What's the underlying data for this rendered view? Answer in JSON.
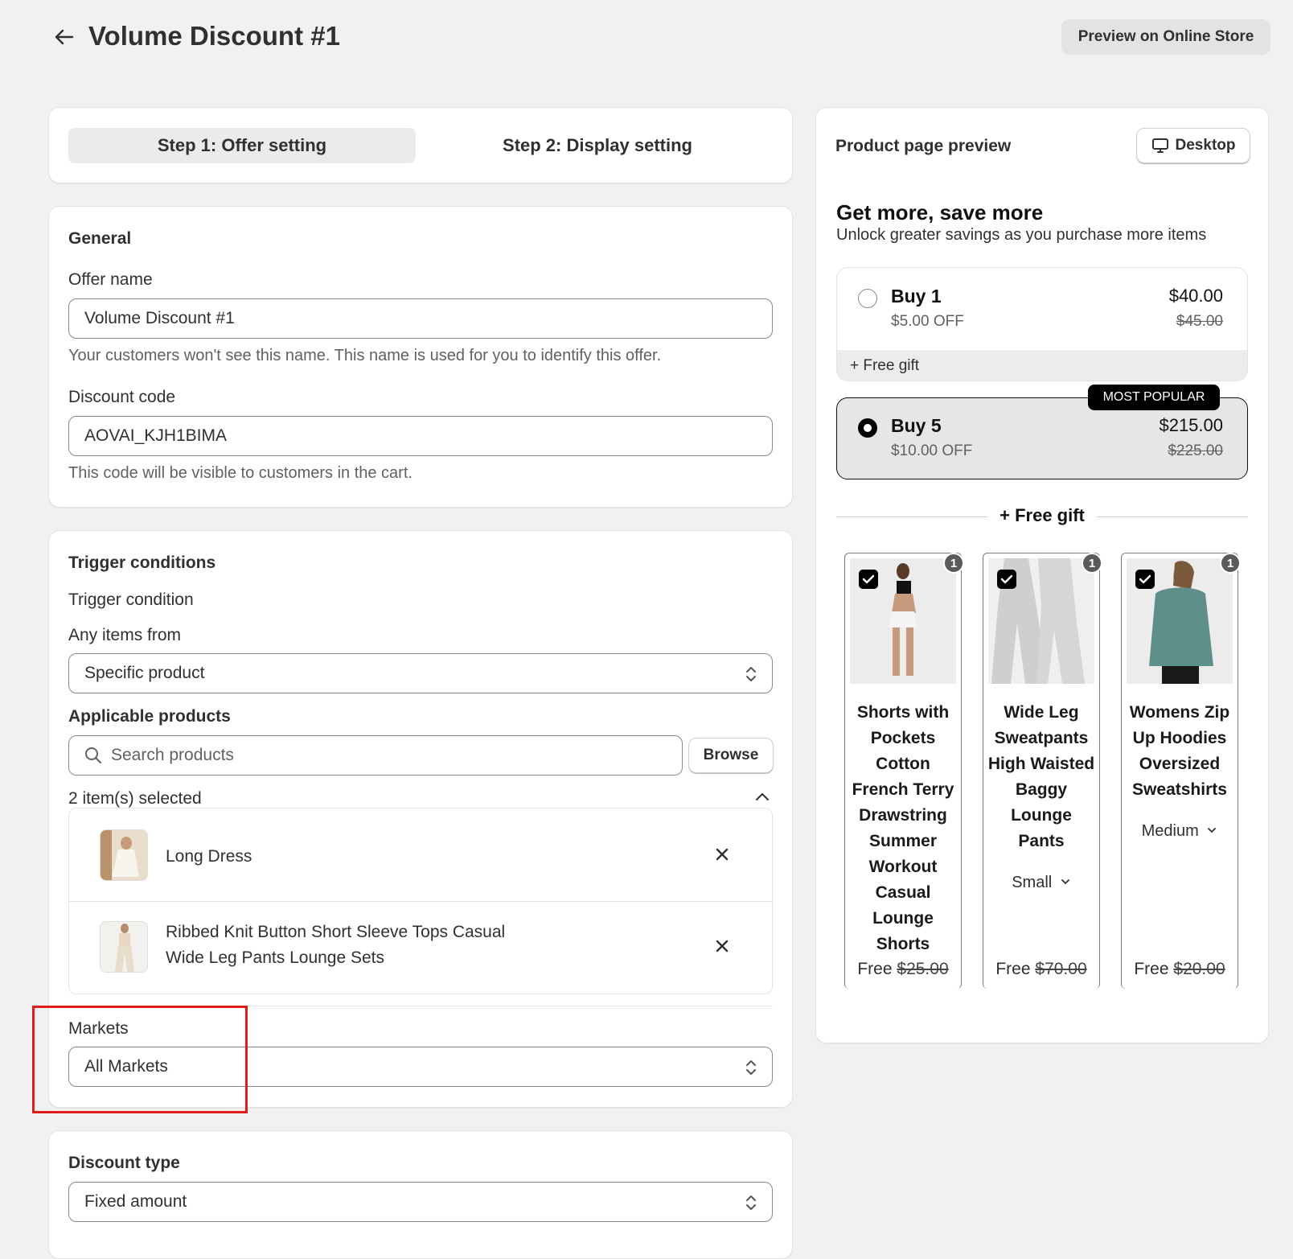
{
  "header": {
    "title": "Volume Discount #1",
    "preview_button": "Preview on Online Store"
  },
  "steps": {
    "step1": "Step 1: Offer setting",
    "step2": "Step 2: Display setting"
  },
  "general": {
    "heading": "General",
    "offer_name_label": "Offer name",
    "offer_name_value": "Volume Discount #1",
    "offer_name_help": "Your customers won't see this name. This name is used for you to identify this offer.",
    "discount_code_label": "Discount code",
    "discount_code_value": "AOVAI_KJH1BIMA",
    "discount_code_help": "This code will be visible to customers in the cart."
  },
  "trigger": {
    "heading": "Trigger conditions",
    "condition_label": "Trigger condition",
    "any_items_label": "Any items from",
    "any_items_value": "Specific product",
    "applicable_label": "Applicable products",
    "search_placeholder": "Search products",
    "browse_button": "Browse",
    "selected_count": "2 item(s) selected",
    "products": [
      {
        "name_line1": "Long Dress",
        "name_line2": ""
      },
      {
        "name_line1": "Ribbed Knit Button Short Sleeve Tops Casual",
        "name_line2": "Wide Leg Pants Lounge Sets"
      }
    ],
    "markets_label": "Markets",
    "markets_value": "All Markets"
  },
  "discount": {
    "heading": "Discount type",
    "value": "Fixed amount"
  },
  "preview": {
    "title": "Product page preview",
    "device_button": "Desktop",
    "headline": "Get more, save more",
    "subheadline": "Unlock greater savings as you purchase more items",
    "tiers": [
      {
        "label": "Buy 1",
        "off": "$5.00 OFF",
        "price": "$40.00",
        "compare": "$45.00",
        "gift_note": "+ Free gift",
        "selected": false
      },
      {
        "label": "Buy 5",
        "off": "$10.00 OFF",
        "price": "$215.00",
        "compare": "$225.00",
        "badge": "MOST POPULAR",
        "selected": true
      }
    ],
    "free_gift_heading": "+ Free gift",
    "gifts": [
      {
        "badge": "1",
        "name": "Shorts with Pockets Cotton French Terry Drawstring Summer Workout Casual Lounge Shorts",
        "variant": "",
        "free": "Free",
        "compare": "$25.00"
      },
      {
        "badge": "1",
        "name": "Wide Leg Sweatpants High Waisted Baggy Lounge Pants",
        "variant": "Small",
        "free": "Free",
        "compare": "$70.00"
      },
      {
        "badge": "1",
        "name": "Womens Zip Up Hoodies Oversized Sweatshirts",
        "variant": "Medium",
        "free": "Free",
        "compare": "$20.00"
      }
    ]
  },
  "colors": {
    "highlight_box": "#e01b1b",
    "selected_tier_bg": "#e6e6e6",
    "badge_bg": "#000000"
  }
}
